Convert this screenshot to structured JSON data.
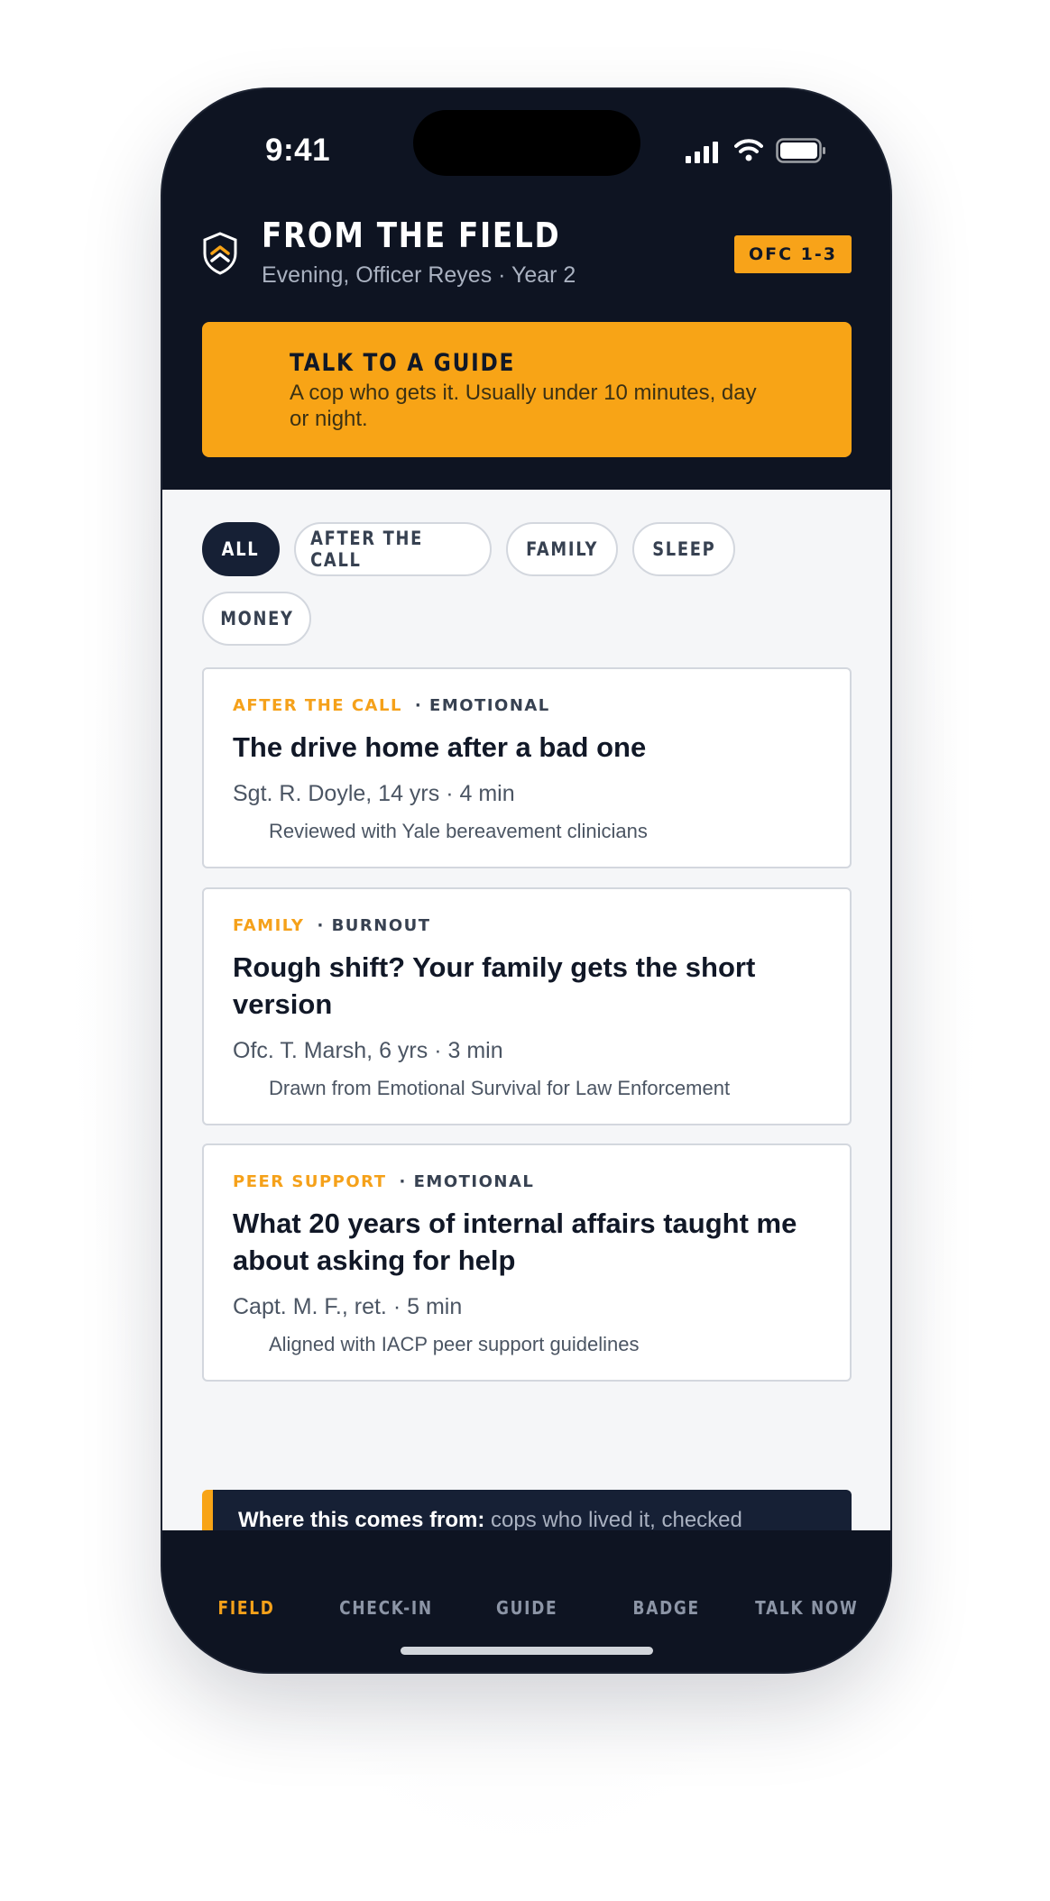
{
  "status_bar": {
    "time": "9:41",
    "signal_icon": "cellular-signal-icon",
    "wifi_icon": "wifi-icon",
    "battery_icon": "battery-icon"
  },
  "header": {
    "logo_icon": "chevron-shield-icon",
    "title": "FROM THE FIELD",
    "subtitle": "Evening, Officer Reyes · Year 2",
    "badge": "OFC 1-3"
  },
  "cta": {
    "title": "TALK TO A GUIDE",
    "description": "A cop who gets it. Usually under 10 minutes, day or night."
  },
  "filters": [
    {
      "label": "ALL",
      "active": true
    },
    {
      "label": "AFTER THE CALL",
      "active": false
    },
    {
      "label": "FAMILY",
      "active": false
    },
    {
      "label": "SLEEP",
      "active": false
    },
    {
      "label": "MONEY",
      "active": false
    }
  ],
  "stories": [
    {
      "category": "AFTER THE CALL",
      "tag": "· EMOTIONAL",
      "title": "The drive home after a bad one",
      "meta": "Sgt. R. Doyle, 14 yrs · 4 min",
      "note": "Reviewed with Yale bereavement clinicians"
    },
    {
      "category": "FAMILY",
      "tag": "· BURNOUT",
      "title": "Rough shift? Your family gets the short version",
      "meta": "Ofc. T. Marsh, 6 yrs · 3 min",
      "note": "Drawn from Emotional Survival for Law Enforcement"
    },
    {
      "category": "PEER SUPPORT",
      "tag": "· EMOTIONAL",
      "title": "What 20 years of internal affairs taught me about asking for help",
      "meta": "Capt. M. F., ret. · 5 min",
      "note": "Aligned with IACP peer support guidelines"
    }
  ],
  "source": {
    "label": "Where this comes from:",
    "text": " cops who lived it, checked against IACP and PERF best practice and Yale bereavement expertise."
  },
  "tabs": [
    {
      "label": "FIELD",
      "active": true
    },
    {
      "label": "CHECK-IN",
      "active": false
    },
    {
      "label": "GUIDE",
      "active": false
    },
    {
      "label": "BADGE",
      "active": false
    },
    {
      "label": "TALK NOW",
      "active": false
    }
  ],
  "colors": {
    "navy": "#0e1422",
    "amber": "#f8a416",
    "card_navy": "#162035"
  }
}
